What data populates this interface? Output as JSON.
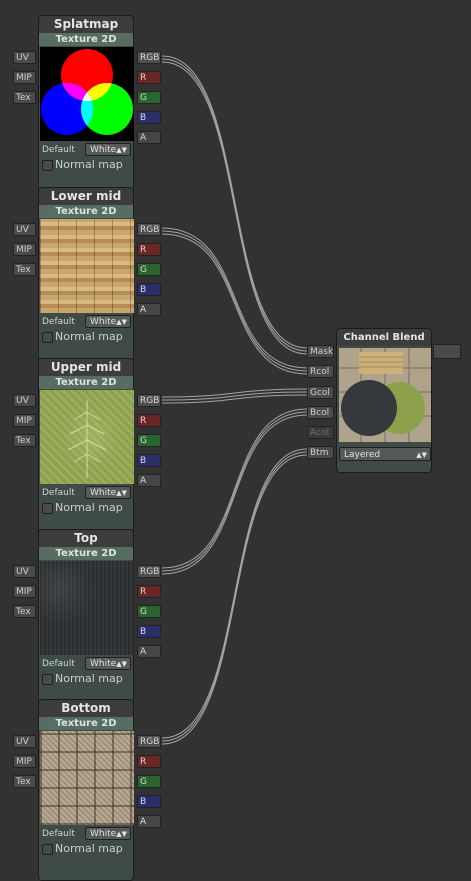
{
  "left_port_labels": [
    "UV",
    "MIP",
    "Tex"
  ],
  "right_port_labels": [
    "RGB",
    "R",
    "G",
    "B",
    "A"
  ],
  "nodes": [
    {
      "title": "Splatmap",
      "subtitle": "Texture 2D",
      "default_label": "Default",
      "select_value": "White",
      "checkbox_label": "Normal map",
      "preview_icon": "rgb-splatmap"
    },
    {
      "title": "Lower mid",
      "subtitle": "Texture 2D",
      "default_label": "Default",
      "select_value": "White",
      "checkbox_label": "Normal map",
      "preview_icon": "wood-texture"
    },
    {
      "title": "Upper mid",
      "subtitle": "Texture 2D",
      "default_label": "Default",
      "select_value": "White",
      "checkbox_label": "Normal map",
      "preview_icon": "grass-texture"
    },
    {
      "title": "Top",
      "subtitle": "Texture 2D",
      "default_label": "Default",
      "select_value": "White",
      "checkbox_label": "Normal map",
      "preview_icon": "dark-stone-texture"
    },
    {
      "title": "Bottom",
      "subtitle": "Texture 2D",
      "default_label": "Default",
      "select_value": "White",
      "checkbox_label": "Normal map",
      "preview_icon": "tile-texture"
    }
  ],
  "channel_blend": {
    "title": "Channel Blend",
    "inputs": [
      "Mask",
      "Rcol",
      "Gcol",
      "Bcol",
      "Acol",
      "Btm"
    ],
    "select_value": "Layered",
    "preview_icon": "blend-preview"
  },
  "colors": {
    "canvas": "#323232",
    "node_body": "#3f4b46",
    "node_sub": "#576d62",
    "r_port": "#6b2525",
    "g_port": "#28662d",
    "b_port": "#2a2f6a",
    "wire": "#b9b9b9"
  }
}
